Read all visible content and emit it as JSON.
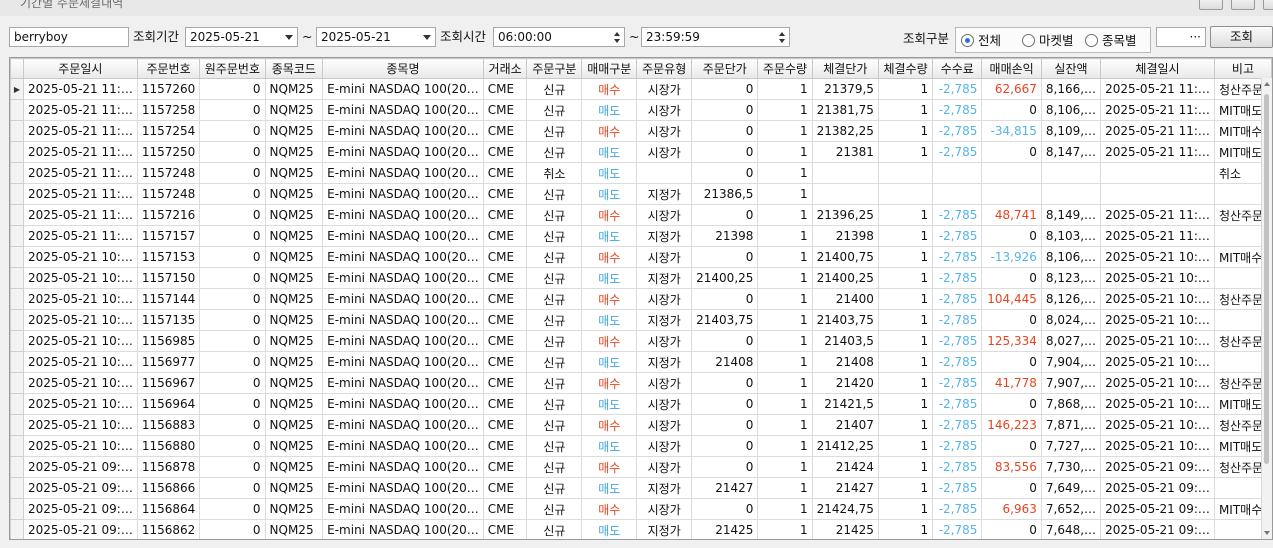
{
  "window": {
    "title": "기간별 주문체결내역"
  },
  "toolbar": {
    "account": "berryboy",
    "period_label": "조회기간",
    "date_from": "2025-05-21",
    "date_to": "2025-05-21",
    "tilde": "~",
    "time_label": "조회시간",
    "time_from": "06:00:00",
    "time_to": "23:59:59",
    "filter_label": "조회구분",
    "radio_all": "전체",
    "radio_market": "마켓별",
    "radio_symbol": "종목별",
    "extra_value": "",
    "extra_button": "···",
    "query_button": "조회"
  },
  "colors": {
    "buy": "#e8441f",
    "sell": "#3ea6dd",
    "fee": "#56b4e9",
    "selected_arrow": "#333333"
  },
  "table": {
    "headers": [
      "주문일시",
      "주문번호",
      "원주문번호",
      "종목코드",
      "종목명",
      "거래소",
      "주문구분",
      "매매구분",
      "주문유형",
      "주문단가",
      "주문수량",
      "체결단가",
      "체결수량",
      "수수료",
      "매매손익",
      "실잔액",
      "체결일시",
      "비고"
    ],
    "rows": [
      [
        "2025-05-21 11:…",
        "1157260",
        "0",
        "NQM25",
        "E-mini NASDAQ 100(20…",
        "CME",
        "신규",
        "매수",
        "시장가",
        "0",
        "1",
        "21379,5",
        "1",
        "-2,785",
        "62,667",
        "8,166,…",
        "2025-05-21 11:…",
        "청산주문"
      ],
      [
        "2025-05-21 11:…",
        "1157258",
        "0",
        "NQM25",
        "E-mini NASDAQ 100(20…",
        "CME",
        "신규",
        "매도",
        "시장가",
        "0",
        "1",
        "21381,75",
        "1",
        "-2,785",
        "0",
        "8,106,…",
        "2025-05-21 11:…",
        "MIT매도"
      ],
      [
        "2025-05-21 11:…",
        "1157254",
        "0",
        "NQM25",
        "E-mini NASDAQ 100(20…",
        "CME",
        "신규",
        "매수",
        "시장가",
        "0",
        "1",
        "21382,25",
        "1",
        "-2,785",
        "-34,815",
        "8,109,…",
        "2025-05-21 11:…",
        "MIT매수"
      ],
      [
        "2025-05-21 11:…",
        "1157250",
        "0",
        "NQM25",
        "E-mini NASDAQ 100(20…",
        "CME",
        "신규",
        "매도",
        "시장가",
        "0",
        "1",
        "21381",
        "1",
        "-2,785",
        "0",
        "8,147,…",
        "2025-05-21 11:…",
        "MIT매도"
      ],
      [
        "2025-05-21 11:…",
        "1157248",
        "0",
        "NQM25",
        "E-mini NASDAQ 100(20…",
        "CME",
        "취소",
        "매도",
        "",
        "0",
        "1",
        "",
        "",
        "",
        "",
        "",
        "",
        "취소"
      ],
      [
        "2025-05-21 11:…",
        "1157248",
        "0",
        "NQM25",
        "E-mini NASDAQ 100(20…",
        "CME",
        "신규",
        "매도",
        "지정가",
        "21386,5",
        "1",
        "",
        "",
        "",
        "",
        "",
        "",
        ""
      ],
      [
        "2025-05-21 11:…",
        "1157216",
        "0",
        "NQM25",
        "E-mini NASDAQ 100(20…",
        "CME",
        "신규",
        "매수",
        "시장가",
        "0",
        "1",
        "21396,25",
        "1",
        "-2,785",
        "48,741",
        "8,149,…",
        "2025-05-21 11:…",
        "청산주문"
      ],
      [
        "2025-05-21 11:…",
        "1157157",
        "0",
        "NQM25",
        "E-mini NASDAQ 100(20…",
        "CME",
        "신규",
        "매도",
        "지정가",
        "21398",
        "1",
        "21398",
        "1",
        "-2,785",
        "0",
        "8,103,…",
        "2025-05-21 11:…",
        ""
      ],
      [
        "2025-05-21 10:…",
        "1157153",
        "0",
        "NQM25",
        "E-mini NASDAQ 100(20…",
        "CME",
        "신규",
        "매수",
        "시장가",
        "0",
        "1",
        "21400,75",
        "1",
        "-2,785",
        "-13,926",
        "8,106,…",
        "2025-05-21 10:…",
        "MIT매수"
      ],
      [
        "2025-05-21 10:…",
        "1157150",
        "0",
        "NQM25",
        "E-mini NASDAQ 100(20…",
        "CME",
        "신규",
        "매도",
        "지정가",
        "21400,25",
        "1",
        "21400,25",
        "1",
        "-2,785",
        "0",
        "8,123,…",
        "2025-05-21 10:…",
        ""
      ],
      [
        "2025-05-21 10:…",
        "1157144",
        "0",
        "NQM25",
        "E-mini NASDAQ 100(20…",
        "CME",
        "신규",
        "매수",
        "시장가",
        "0",
        "1",
        "21400",
        "1",
        "-2,785",
        "104,445",
        "8,126,…",
        "2025-05-21 10:…",
        "청산주문"
      ],
      [
        "2025-05-21 10:…",
        "1157135",
        "0",
        "NQM25",
        "E-mini NASDAQ 100(20…",
        "CME",
        "신규",
        "매도",
        "지정가",
        "21403,75",
        "1",
        "21403,75",
        "1",
        "-2,785",
        "0",
        "8,024,…",
        "2025-05-21 10:…",
        ""
      ],
      [
        "2025-05-21 10:…",
        "1156985",
        "0",
        "NQM25",
        "E-mini NASDAQ 100(20…",
        "CME",
        "신규",
        "매수",
        "시장가",
        "0",
        "1",
        "21403,5",
        "1",
        "-2,785",
        "125,334",
        "8,027,…",
        "2025-05-21 10:…",
        "청산주문"
      ],
      [
        "2025-05-21 10:…",
        "1156977",
        "0",
        "NQM25",
        "E-mini NASDAQ 100(20…",
        "CME",
        "신규",
        "매도",
        "지정가",
        "21408",
        "1",
        "21408",
        "1",
        "-2,785",
        "0",
        "7,904,…",
        "2025-05-21 10:…",
        ""
      ],
      [
        "2025-05-21 10:…",
        "1156967",
        "0",
        "NQM25",
        "E-mini NASDAQ 100(20…",
        "CME",
        "신규",
        "매수",
        "시장가",
        "0",
        "1",
        "21420",
        "1",
        "-2,785",
        "41,778",
        "7,907,…",
        "2025-05-21 10:…",
        "청산주문"
      ],
      [
        "2025-05-21 10:…",
        "1156964",
        "0",
        "NQM25",
        "E-mini NASDAQ 100(20…",
        "CME",
        "신규",
        "매도",
        "시장가",
        "0",
        "1",
        "21421,5",
        "1",
        "-2,785",
        "0",
        "7,868,…",
        "2025-05-21 10:…",
        "MIT매도"
      ],
      [
        "2025-05-21 10:…",
        "1156883",
        "0",
        "NQM25",
        "E-mini NASDAQ 100(20…",
        "CME",
        "신규",
        "매수",
        "시장가",
        "0",
        "1",
        "21407",
        "1",
        "-2,785",
        "146,223",
        "7,871,…",
        "2025-05-21 10:…",
        "청산주문"
      ],
      [
        "2025-05-21 10:…",
        "1156880",
        "0",
        "NQM25",
        "E-mini NASDAQ 100(20…",
        "CME",
        "신규",
        "매도",
        "시장가",
        "0",
        "1",
        "21412,25",
        "1",
        "-2,785",
        "0",
        "7,727,…",
        "2025-05-21 10:…",
        "MIT매도"
      ],
      [
        "2025-05-21 09:…",
        "1156878",
        "0",
        "NQM25",
        "E-mini NASDAQ 100(20…",
        "CME",
        "신규",
        "매수",
        "시장가",
        "0",
        "1",
        "21424",
        "1",
        "-2,785",
        "83,556",
        "7,730,…",
        "2025-05-21 09:…",
        "청산주문"
      ],
      [
        "2025-05-21 09:…",
        "1156866",
        "0",
        "NQM25",
        "E-mini NASDAQ 100(20…",
        "CME",
        "신규",
        "매도",
        "지정가",
        "21427",
        "1",
        "21427",
        "1",
        "-2,785",
        "0",
        "7,649,…",
        "2025-05-21 09:…",
        ""
      ],
      [
        "2025-05-21 09:…",
        "1156864",
        "0",
        "NQM25",
        "E-mini NASDAQ 100(20…",
        "CME",
        "신규",
        "매수",
        "시장가",
        "0",
        "1",
        "21424,75",
        "1",
        "-2,785",
        "6,963",
        "7,652,…",
        "2025-05-21 09:…",
        "MIT매수"
      ],
      [
        "2025-05-21 09:…",
        "1156862",
        "0",
        "NQM25",
        "E-mini NASDAQ 100(20…",
        "CME",
        "신규",
        "매도",
        "지정가",
        "21425",
        "1",
        "21425",
        "1",
        "-2,785",
        "0",
        "7,648,…",
        "2025-05-21 09:…",
        ""
      ]
    ],
    "selected_row": 0
  }
}
